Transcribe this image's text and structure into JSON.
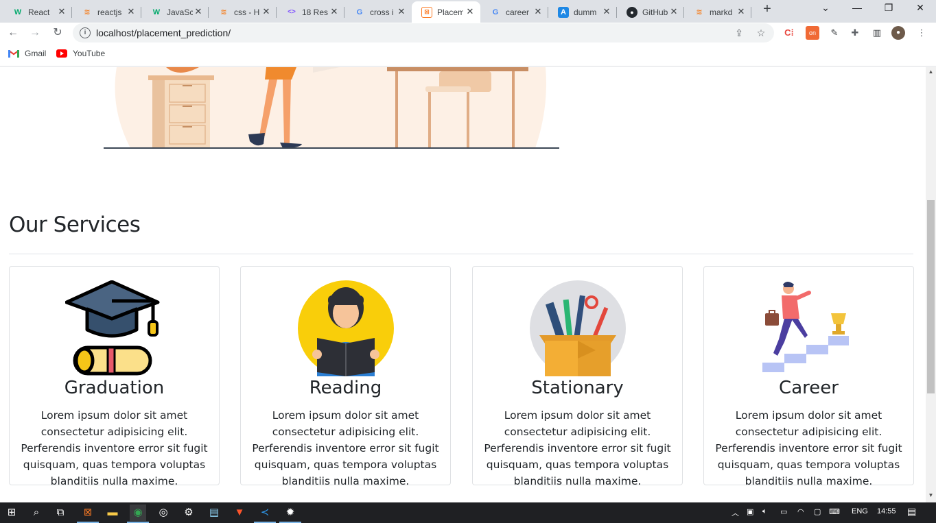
{
  "tabs": [
    {
      "title": "React",
      "icon": "w3schools-icon",
      "favtext": "W",
      "color": "#04aa6d"
    },
    {
      "title": "reactjs",
      "icon": "stackoverflow-icon",
      "favtext": "≋",
      "color": "#f48024"
    },
    {
      "title": "JavaSc",
      "icon": "w3schools-icon",
      "favtext": "W",
      "color": "#04aa6d"
    },
    {
      "title": "css - H",
      "icon": "stackoverflow-icon",
      "favtext": "≋",
      "color": "#f48024"
    },
    {
      "title": "18 Res",
      "icon": "code-brackets-icon",
      "favtext": "<>",
      "color": "#7c4dff"
    },
    {
      "title": "cross i",
      "icon": "google-icon",
      "favtext": "G",
      "color": "#4285f4"
    },
    {
      "title": "Placem",
      "icon": "xampp-icon",
      "favtext": "⊠",
      "color": "#fb7a24"
    },
    {
      "title": "career",
      "icon": "google-icon",
      "favtext": "G",
      "color": "#4285f4"
    },
    {
      "title": "dumm",
      "icon": "a-logo-icon",
      "favtext": "A",
      "color": "#1e88e5"
    },
    {
      "title": "GitHub",
      "icon": "github-icon",
      "favtext": "●",
      "color": "#24292f"
    },
    {
      "title": "markd",
      "icon": "stackoverflow-icon",
      "favtext": "≋",
      "color": "#f48024"
    }
  ],
  "active_tab_index": 6,
  "address_bar": {
    "url": "localhost/placement_prediction/"
  },
  "bookmarks": [
    {
      "label": "Gmail",
      "icon": "gmail-icon"
    },
    {
      "label": "YouTube",
      "icon": "youtube-icon"
    }
  ],
  "page": {
    "services_title": "Our Services",
    "cards": [
      {
        "title": "Graduation",
        "icon": "graduation-cap-icon",
        "text": "Lorem ipsum dolor sit amet consectetur adipisicing elit. Perferendis inventore error sit fugit quisquam, quas tempora voluptas blanditiis nulla maxime."
      },
      {
        "title": "Reading",
        "icon": "reading-student-icon",
        "text": "Lorem ipsum dolor sit amet consectetur adipisicing elit. Perferendis inventore error sit fugit quisquam, quas tempora voluptas blanditiis nulla maxime."
      },
      {
        "title": "Stationary",
        "icon": "stationery-box-icon",
        "text": "Lorem ipsum dolor sit amet consectetur adipisicing elit. Perferendis inventore error sit fugit quisquam, quas tempora voluptas blanditiis nulla maxime."
      },
      {
        "title": "Career",
        "icon": "career-stairs-icon",
        "text": "Lorem ipsum dolor sit amet consectetur adipisicing elit. Perferendis inventore error sit fugit quisquam, quas tempora voluptas blanditiis nulla maxime."
      }
    ]
  },
  "taskbar": {
    "language": "ENG",
    "time": "14:55"
  },
  "colors": {
    "tabstrip_bg": "#dee1e6",
    "taskbar_bg": "#1f2023",
    "text": "#212529",
    "card_border": "#dfe1e4"
  }
}
